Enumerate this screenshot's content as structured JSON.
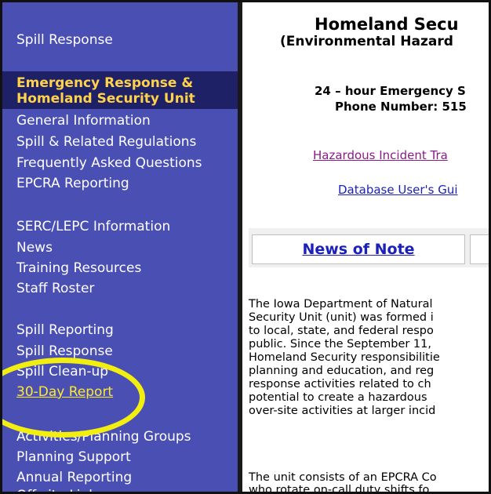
{
  "sidebar": {
    "items": [
      {
        "id": "spill-response-top",
        "label": "Spill Response"
      },
      {
        "id": "general-information",
        "label": "General Information"
      },
      {
        "id": "spill-regulations",
        "label": "Spill & Related Regulations"
      },
      {
        "id": "faq",
        "label": "Frequently Asked Questions"
      },
      {
        "id": "epcra-reporting",
        "label": "EPCRA Reporting"
      },
      {
        "id": "serc-lepc",
        "label": "SERC/LEPC Information"
      },
      {
        "id": "news",
        "label": "News"
      },
      {
        "id": "training-resources",
        "label": "Training Resources"
      },
      {
        "id": "staff-roster",
        "label": "Staff Roster"
      },
      {
        "id": "spill-reporting",
        "label": "Spill Reporting"
      },
      {
        "id": "spill-response",
        "label": "Spill Response"
      },
      {
        "id": "spill-clean-up",
        "label": "Spill Clean-up"
      },
      {
        "id": "30-day-report",
        "label": "30-Day Report"
      },
      {
        "id": "activities-planning",
        "label": "Activities/Planning Groups"
      },
      {
        "id": "planning-support",
        "label": "Planning Support"
      },
      {
        "id": "annual-reporting",
        "label": "Annual Reporting"
      },
      {
        "id": "off-site-links",
        "label": "Off-site Links"
      }
    ],
    "header": {
      "line1": "Emergency Response &",
      "line2": "Homeland Security Unit"
    },
    "colors": {
      "background": "#4a4fb4",
      "header_bg": "#1f2167",
      "header_text": "#ffd24a",
      "highlight": "#f2ee0f"
    }
  },
  "main": {
    "title_line1": "Homeland Secu",
    "title_line2": "(Environmental Hazard",
    "phone_line1": "24 – hour Emergency S",
    "phone_line2": "Phone Number: 515",
    "hazard_link": "Hazardous Incident Tra",
    "db_guide_link": "Database User's Gui",
    "tab_label": "News of Note",
    "paragraph1": [
      "The Iowa Department of Natural",
      "Security Unit (unit) was formed i",
      "to local, state, and federal respo",
      "public. Since the September 11,",
      "Homeland Security responsibilitie",
      "planning and education, and reg",
      "response activities related to ch",
      "potential to create a hazardous",
      "over-site activities at larger incid"
    ],
    "paragraph2": [
      "The unit consists of an EPCRA Co",
      "who rotate on-call duty shifts fo"
    ]
  }
}
